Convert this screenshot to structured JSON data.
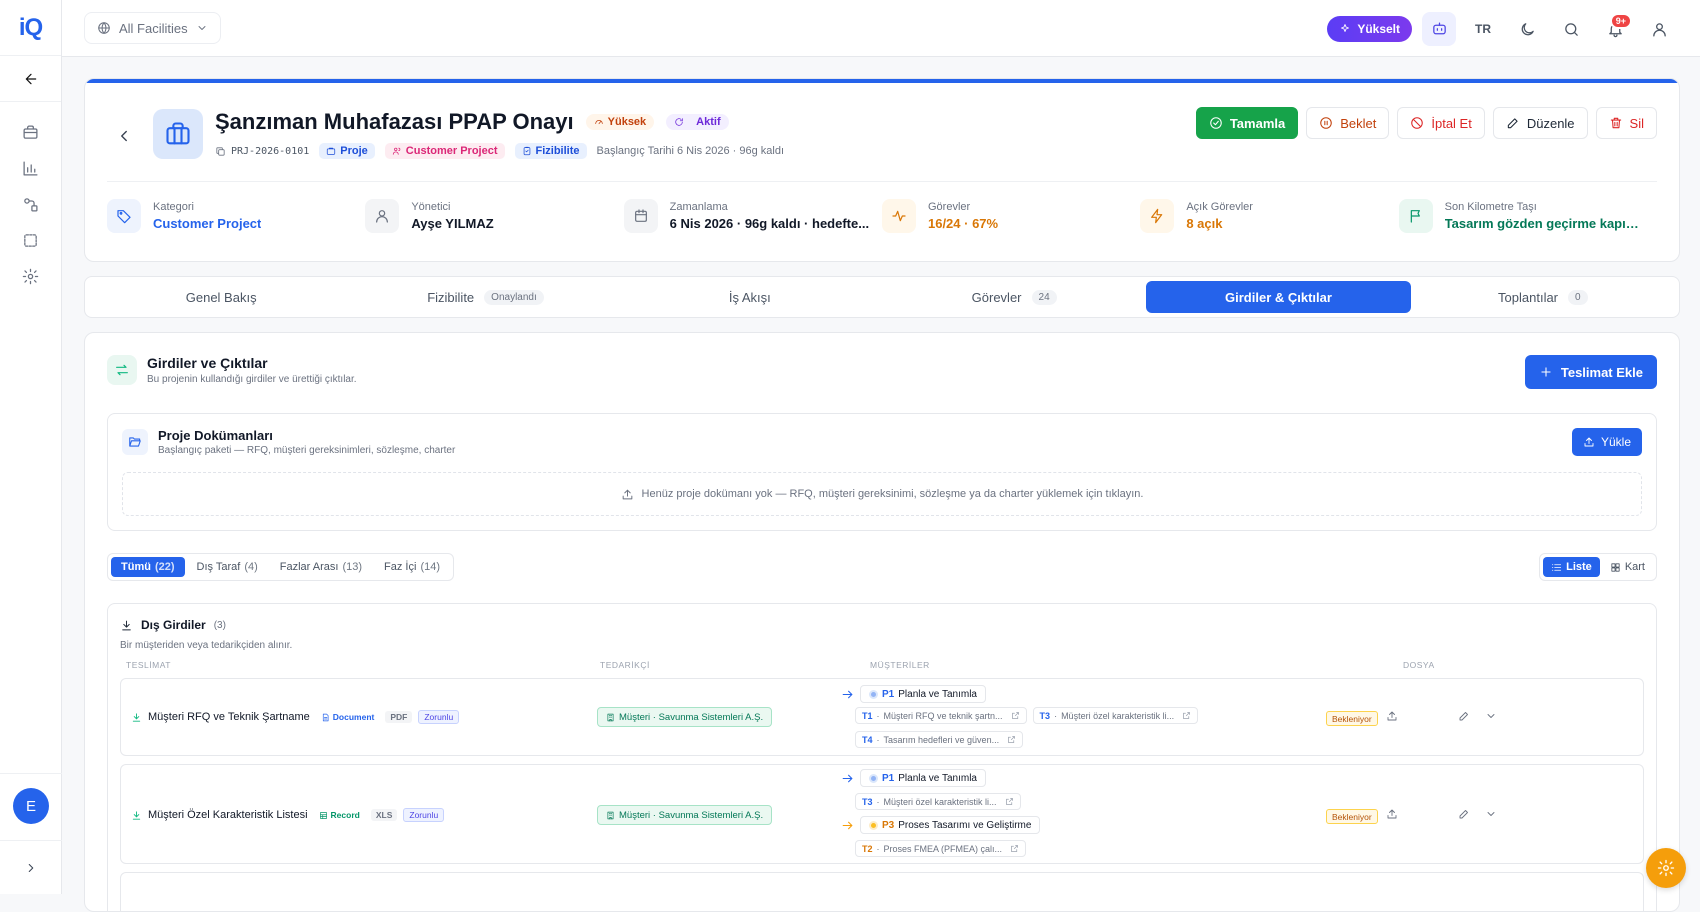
{
  "app": {
    "logo_text": "iQ"
  },
  "topbar": {
    "facility_selector": "All Facilities",
    "upgrade_label": "Yükselt",
    "language": "TR",
    "notification_count": "9+"
  },
  "sidebar": {
    "user_initial": "E"
  },
  "project": {
    "title": "Şanzıman Muhafazası PPAP Onayı",
    "priority": "Yüksek",
    "status": "Aktif",
    "code": "PRJ-2026-0101",
    "tag_project": "Proje",
    "tag_customer": "Customer Project",
    "tag_feasibility": "Fizibilite",
    "start_info": "Başlangıç Tarihi 6 Nis 2026 · 96g kaldı"
  },
  "actions": {
    "complete": "Tamamla",
    "hold": "Beklet",
    "cancel": "İptal Et",
    "edit": "Düzenle",
    "delete": "Sil"
  },
  "stats": [
    {
      "label": "Kategori",
      "value": "Customer Project",
      "color": "#2563eb"
    },
    {
      "label": "Yönetici",
      "value": "Ayşe YILMAZ",
      "color": "#111827"
    },
    {
      "label": "Zamanlama",
      "value": "6 Nis 2026 · 96g kaldı · hedefte...",
      "color": "#111827"
    },
    {
      "label": "Görevler",
      "value": "16/24 · 67%",
      "color": "#d97706"
    },
    {
      "label": "Açık Görevler",
      "value": "8 açık",
      "color": "#d97706"
    },
    {
      "label": "Son Kilometre Taşı",
      "value": "Tasarım gözden geçirme kapısı...",
      "color": "#047857"
    }
  ],
  "tabs": [
    {
      "label": "Genel Bakış",
      "count": ""
    },
    {
      "label": "Fizibilite",
      "count": "Onaylandı"
    },
    {
      "label": "İş Akışı",
      "count": ""
    },
    {
      "label": "Görevler",
      "count": "24"
    },
    {
      "label": "Girdiler & Çıktılar",
      "count": ""
    },
    {
      "label": "Toplantılar",
      "count": "0"
    }
  ],
  "io": {
    "title": "Girdiler ve Çıktılar",
    "subtitle": "Bu projenin kullandığı girdiler ve ürettiği çıktılar.",
    "add_button": "Teslimat Ekle"
  },
  "docs": {
    "title": "Proje Dokümanları",
    "subtitle": "Başlangıç paketi — RFQ, müşteri gereksinimleri, sözleşme, charter",
    "upload_button": "Yükle",
    "empty_text": "Henüz proje dokümanı yok — RFQ, müşteri gereksinimi, sözleşme ya da charter yüklemek için tıklayın."
  },
  "filters": [
    {
      "label": "Tümü",
      "count": "(22)"
    },
    {
      "label": "Dış Taraf",
      "count": "(4)"
    },
    {
      "label": "Fazlar Arası",
      "count": "(13)"
    },
    {
      "label": "Faz İçi",
      "count": "(14)"
    }
  ],
  "view": {
    "list": "Liste",
    "card": "Kart"
  },
  "external_inputs": {
    "title": "Dış Girdiler",
    "count": "(3)",
    "subtitle": "Bir müşteriden veya tedarikçiden alınır.",
    "columns": {
      "deliverable": "TESLİMAT",
      "supplier": "TEDARİKÇİ",
      "customers": "MÜŞTERİLER",
      "file": "DOSYA"
    },
    "rows": [
      {
        "name": "Müşteri RFQ ve Teknik Şartname",
        "type": "Document",
        "format": "PDF",
        "required": "Zorunlu",
        "supplier": "Müşteri · Savunma Sistemleri A.Ş.",
        "status": "Bekleniyor",
        "phase1": {
          "code": "P1",
          "name": "Planla ve Tanımla"
        },
        "tasks": [
          {
            "code": "T1",
            "name": "Müşteri RFQ ve teknik şartn..."
          },
          {
            "code": "T3",
            "name": "Müşteri özel karakteristik li..."
          },
          {
            "code": "T4",
            "name": "Tasarım hedefleri ve güven..."
          }
        ]
      },
      {
        "name": "Müşteri Özel Karakteristik Listesi",
        "type": "Record",
        "format": "XLS",
        "required": "Zorunlu",
        "supplier": "Müşteri · Savunma Sistemleri A.Ş.",
        "status": "Bekleniyor",
        "phase1": {
          "code": "P1",
          "name": "Planla ve Tanımla"
        },
        "tasks": [
          {
            "code": "T3",
            "name": "Müşteri özel karakteristik li..."
          }
        ],
        "phase2": {
          "code": "P3",
          "name": "Proses Tasarımı ve Geliştirme"
        },
        "tasks2": [
          {
            "code": "T2",
            "name": "Proses FMEA (PFMEA) çalı..."
          }
        ]
      }
    ]
  }
}
